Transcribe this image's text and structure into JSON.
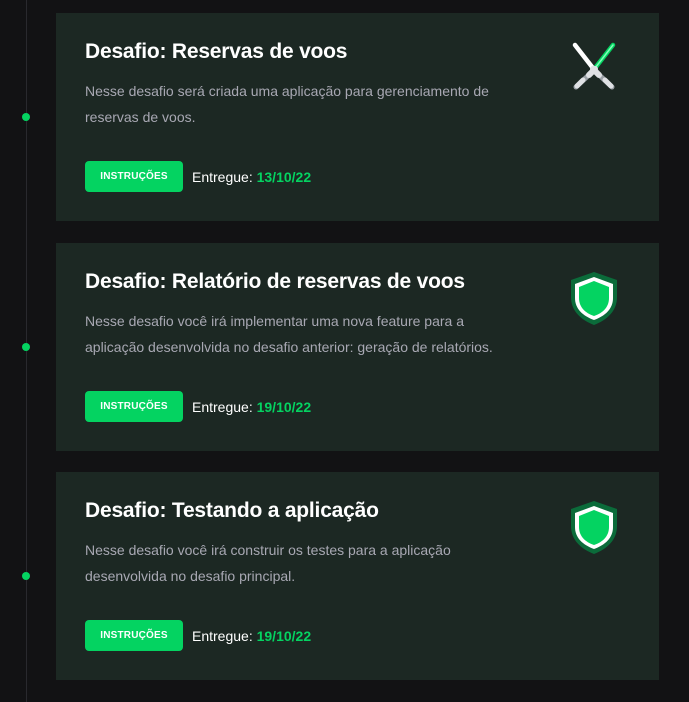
{
  "challenges": [
    {
      "title": "Desafio: Reservas de voos",
      "description": "Nesse desafio será criada uma aplicação para gerenciamento de reservas de voos.",
      "button_label": "INSTRUÇÕES",
      "delivery_label": "Entregue:",
      "delivery_date": "13/10/22",
      "icon": "crossed-sabers-icon"
    },
    {
      "title": "Desafio: Relatório de reservas de voos",
      "description": "Nesse desafio você irá implementar uma nova feature para a aplicação desenvolvida no desafio anterior: geração de relatórios.",
      "button_label": "INSTRUÇÕES",
      "delivery_label": "Entregue:",
      "delivery_date": "19/10/22",
      "icon": "shield-icon"
    },
    {
      "title": "Desafio: Testando a aplicação",
      "description": "Nesse desafio você irá construir os testes para a aplicação desenvolvida no desafio principal.",
      "button_label": "INSTRUÇÕES",
      "delivery_label": "Entregue:",
      "delivery_date": "19/10/22",
      "icon": "shield-icon"
    }
  ],
  "colors": {
    "accent": "#04d361",
    "background": "#121214",
    "card": "#1c2823",
    "shield_border": "#0b6b3a"
  }
}
